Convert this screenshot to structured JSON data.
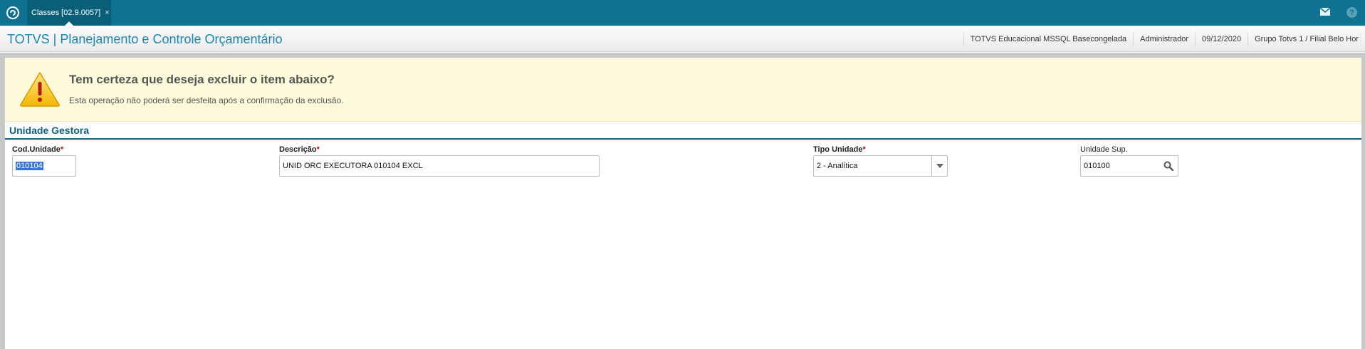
{
  "topbar": {
    "tab_label": "Classes [02.9.0057]",
    "tab_close": "×",
    "help_label": "?"
  },
  "header": {
    "title": "TOTVS | Planejamento e Controle Orçamentário",
    "info": [
      "TOTVS Educacional MSSQL Basecongelada",
      "Administrador",
      "09/12/2020",
      "Grupo Totvs 1 / Filial Belo Hor"
    ]
  },
  "warning": {
    "title": "Tem certeza que deseja excluir o item abaixo?",
    "text": "Esta operação não poderá ser desfeita após a confirmação da exclusão."
  },
  "section": {
    "title": "Unidade Gestora"
  },
  "fields": {
    "cod_unidade": {
      "label": "Cod.Unidade",
      "required": "*",
      "value": "010104"
    },
    "descricao": {
      "label": "Descrição",
      "required": "*",
      "value": "UNID ORC EXECUTORA 010104 EXCL"
    },
    "tipo_unidade": {
      "label": "Tipo Unidade",
      "required": "*",
      "value": "2 - Analítica"
    },
    "unidade_sup": {
      "label": "Unidade Sup.",
      "value": "010100"
    }
  },
  "colors": {
    "topbar": "#0e7290",
    "title": "#1a87b5",
    "section": "#0e5f82",
    "warning_bg": "#fdfbdc",
    "required": "#d40000"
  },
  "icons": [
    "app-logo-icon",
    "close-icon",
    "mail-icon",
    "help-icon",
    "warning-icon",
    "chevron-down-icon",
    "search-icon"
  ]
}
